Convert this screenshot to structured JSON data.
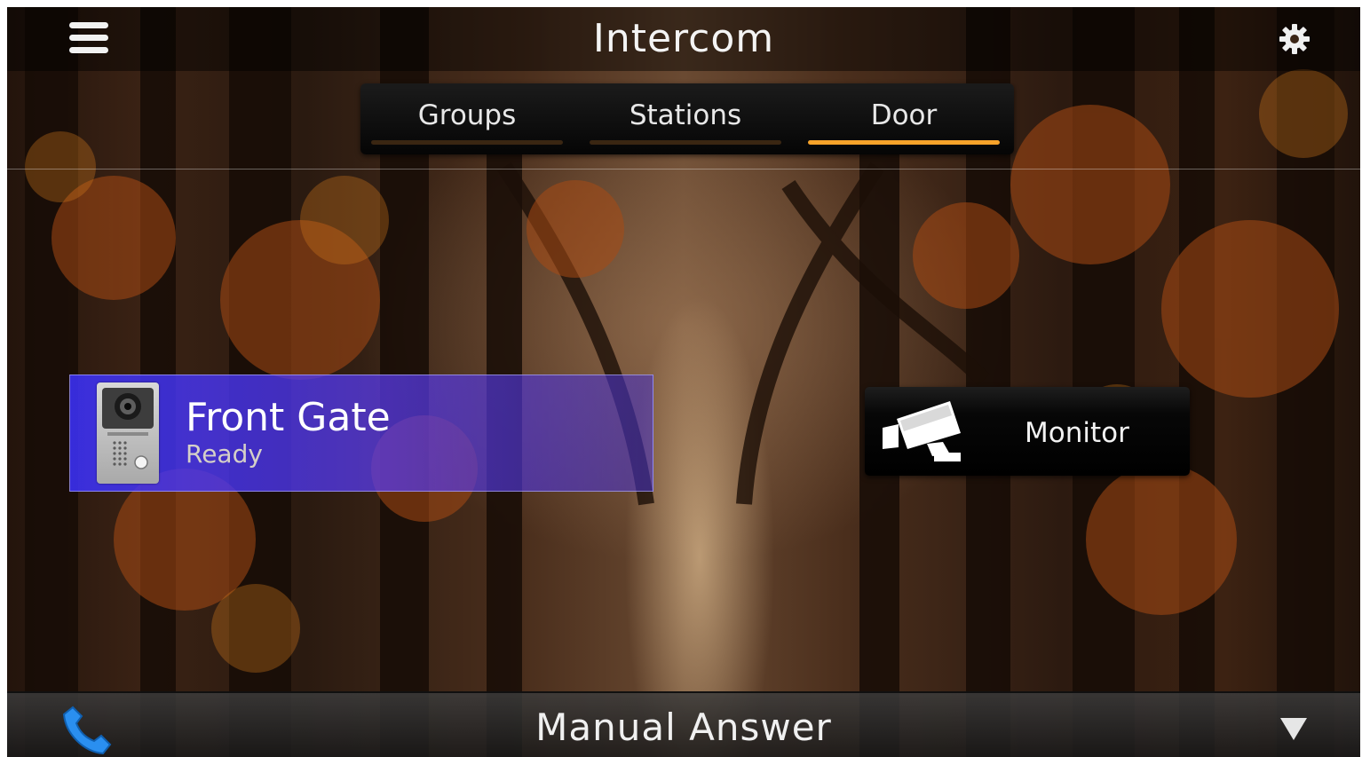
{
  "app": {
    "title": "Intercom"
  },
  "header": {
    "menu_icon": "hamburger-menu-icon",
    "settings_icon": "gear-icon"
  },
  "tabs": [
    {
      "label": "Groups",
      "active": false
    },
    {
      "label": "Stations",
      "active": false
    },
    {
      "label": "Door",
      "active": true
    }
  ],
  "door": {
    "name": "Front Gate",
    "status": "Ready",
    "icon": "door-station-icon"
  },
  "monitor": {
    "label": "Monitor",
    "icon": "camera-icon"
  },
  "footer": {
    "answer_mode": "Manual Answer",
    "phone_icon": "phone-icon",
    "dropdown_icon": "triangle-down-icon"
  },
  "colors": {
    "tab_active": "#f7a32a",
    "door_card": "#3c32ff"
  }
}
